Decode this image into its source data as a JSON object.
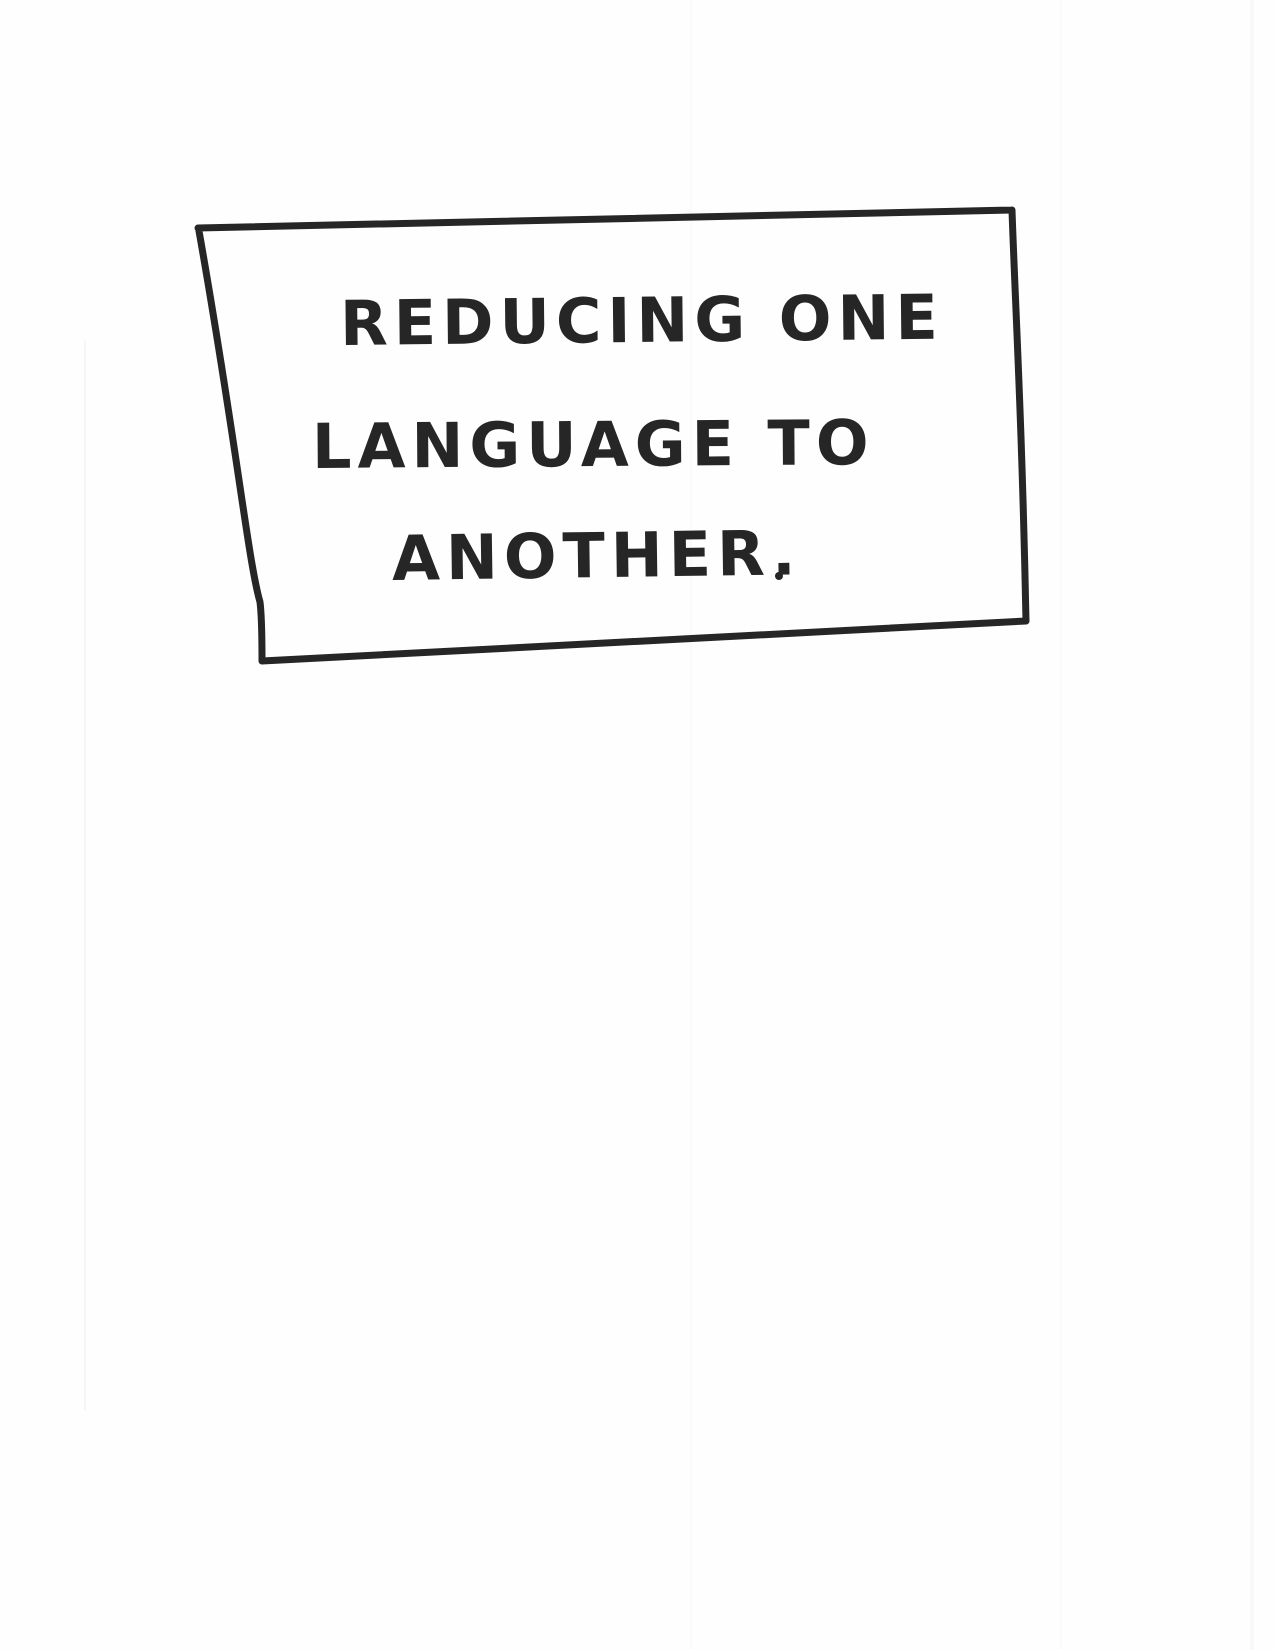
{
  "note": {
    "lines": [
      "REDUCING ONE",
      "LANGUAGE TO",
      "ANOTHER."
    ]
  },
  "colors": {
    "ink": "#262626",
    "paper": "#fefefe"
  }
}
